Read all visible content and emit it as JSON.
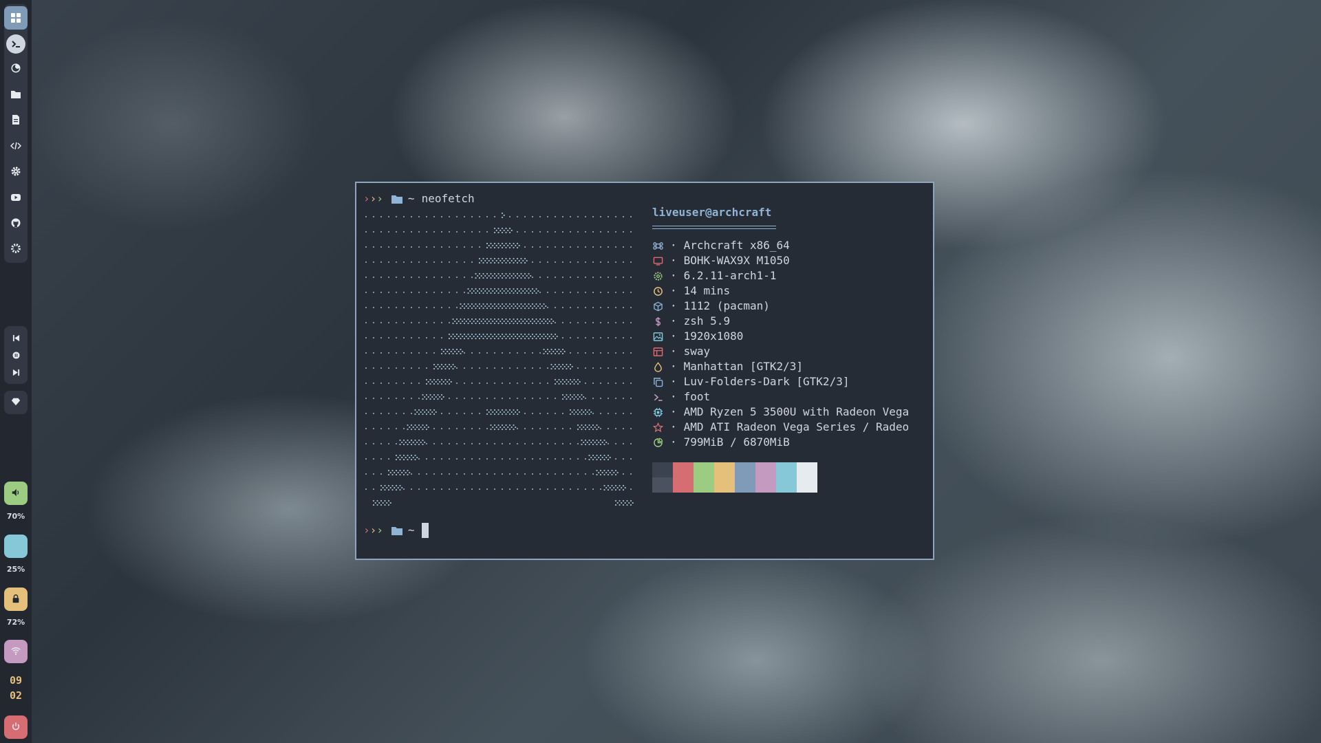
{
  "dock": {
    "apps": [
      {
        "name": "terminal",
        "icon": "terminal-icon"
      },
      {
        "name": "firefox",
        "icon": "firefox-icon"
      },
      {
        "name": "files",
        "icon": "folder-icon"
      },
      {
        "name": "editor",
        "icon": "document-icon"
      },
      {
        "name": "code",
        "icon": "code-icon"
      },
      {
        "name": "settings",
        "icon": "gear-icon"
      },
      {
        "name": "youtube",
        "icon": "youtube-icon"
      },
      {
        "name": "github",
        "icon": "github-icon"
      },
      {
        "name": "system-settings",
        "icon": "cog-icon"
      }
    ],
    "volume_pct": "70%",
    "brightness_pct": "25%",
    "battery_pct": "72%",
    "clock_hour": "09",
    "clock_minute": "02",
    "colors": {
      "volume": "#9ccc82",
      "brightness": "#86c8d8",
      "battery": "#e5c07b",
      "network": "#c49ac0",
      "power": "#d66d73"
    }
  },
  "terminal": {
    "prompt1": {
      "arrows": [
        "›",
        "›",
        "›"
      ],
      "dir": "~",
      "command": "neofetch"
    },
    "prompt2": {
      "arrows": [
        "›",
        "›",
        "›"
      ],
      "dir": "~"
    },
    "info_title": "liveuser@archcraft",
    "info_rows": [
      {
        "icon": "command-icon",
        "color": "#8fb4d6",
        "text": "Archcraft x86_64"
      },
      {
        "icon": "monitor-icon",
        "color": "#d66d73",
        "text": "BOHK-WAX9X M1050"
      },
      {
        "icon": "gear-icon",
        "color": "#9ccc82",
        "text": "6.2.11-arch1-1"
      },
      {
        "icon": "clock-icon",
        "color": "#e5c07b",
        "text": "14 mins"
      },
      {
        "icon": "package-icon",
        "color": "#8fb4d6",
        "text": "1112 (pacman)"
      },
      {
        "icon": "dollar-icon",
        "color": "#c49ac0",
        "text": "zsh 5.9"
      },
      {
        "icon": "image-icon",
        "color": "#86c8d8",
        "text": "1920x1080"
      },
      {
        "icon": "layout-icon",
        "color": "#d66d73",
        "text": "sway"
      },
      {
        "icon": "drop-icon",
        "color": "#e5c07b",
        "text": "Manhattan [GTK2/3]"
      },
      {
        "icon": "copy-icon",
        "color": "#8fb4d6",
        "text": "Luv-Folders-Dark [GTK2/3]"
      },
      {
        "icon": "prompt-icon",
        "color": "#c49ac0",
        "text": "foot"
      },
      {
        "icon": "cpu-icon",
        "color": "#86c8d8",
        "text": "AMD Ryzen 5 3500U with Radeon Vega"
      },
      {
        "icon": "star-icon",
        "color": "#d66d73",
        "text": "AMD ATI Radeon Vega Series / Radeo"
      },
      {
        "icon": "pie-icon",
        "color": "#9ccc82",
        "text": "799MiB / 6870MiB"
      }
    ],
    "separator": "·",
    "palette": [
      "#3b4250",
      "#d66d73",
      "#9ccc82",
      "#e5c07b",
      "#7f9bb8",
      "#c49ac0",
      "#86c8d8",
      "#e6ebf0"
    ],
    "colors": {
      "bg": "#262c36",
      "border": "#8ea4bf",
      "accent": "#8fb4d6"
    }
  }
}
